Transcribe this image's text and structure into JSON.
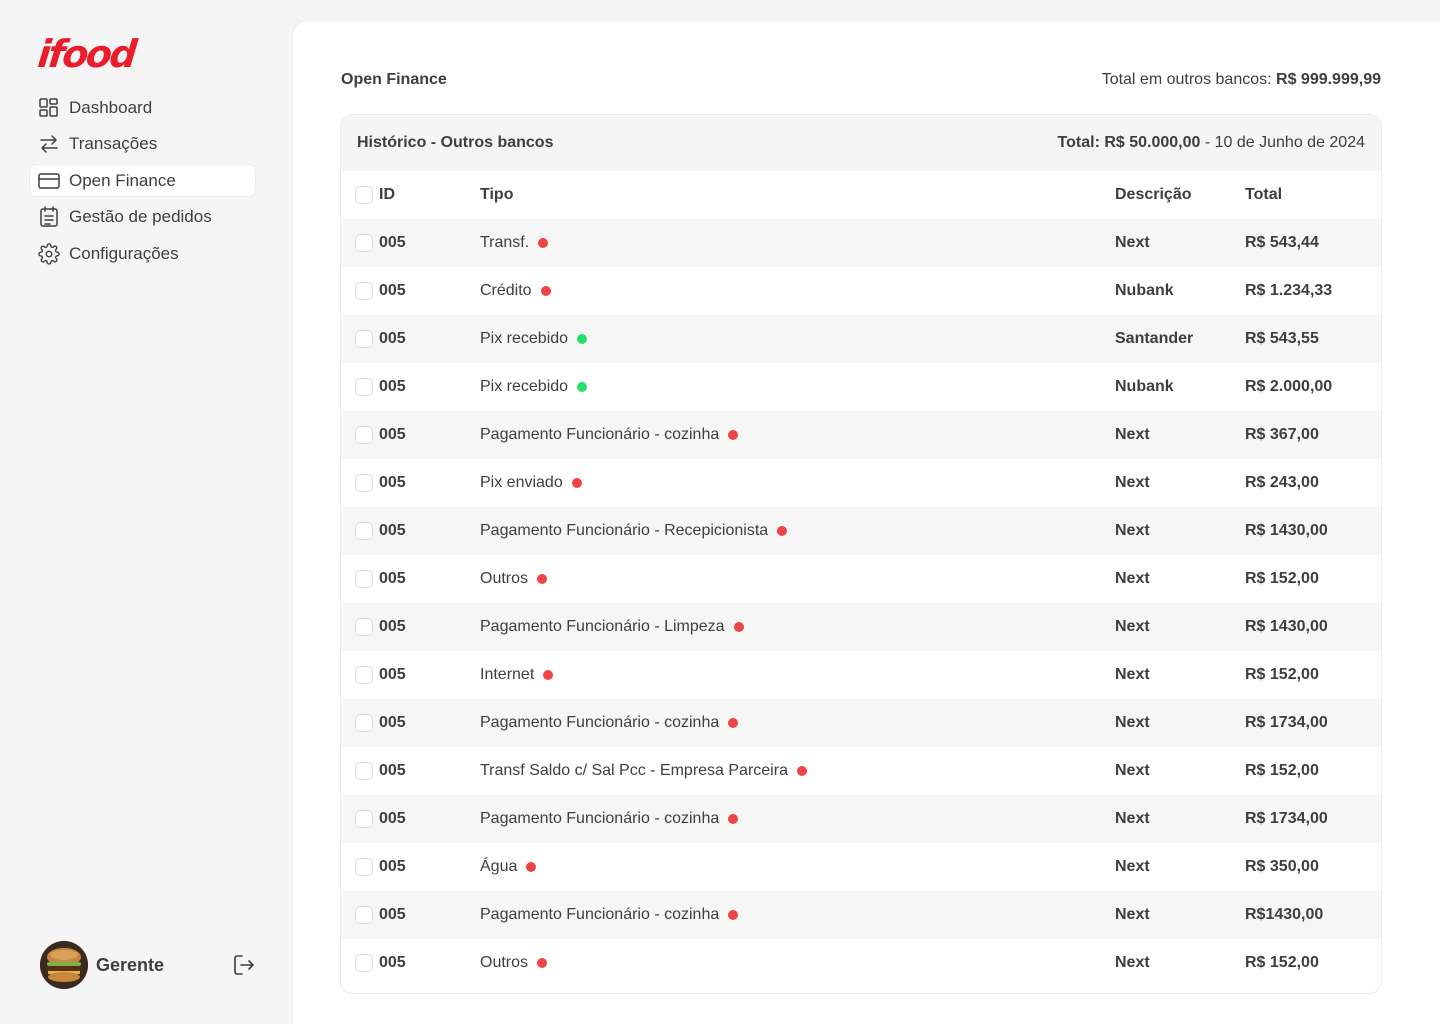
{
  "brand": {
    "logo_text": "ifood",
    "color": "#ea1d2c"
  },
  "sidebar": {
    "items": [
      {
        "label": "Dashboard",
        "icon": "grid-icon",
        "active": false
      },
      {
        "label": "Transações",
        "icon": "arrows-exchange-icon",
        "active": false
      },
      {
        "label": "Open Finance",
        "icon": "credit-card-icon",
        "active": true
      },
      {
        "label": "Gestão de pedidos",
        "icon": "clipboard-icon",
        "active": false
      },
      {
        "label": "Configurações",
        "icon": "gear-icon",
        "active": false
      }
    ],
    "user": {
      "name": "Gerente",
      "avatar": "burger-avatar",
      "logout_icon": "logout-icon"
    }
  },
  "main": {
    "title": "Open Finance",
    "total_other_label": "Total em outros bancos:",
    "total_other_value": "R$ 999.999,99"
  },
  "table": {
    "title": "Histórico - Outros bancos",
    "total_label": "Total: R$ 50.000,00",
    "total_date": " - 10 de Junho de 2024",
    "columns": {
      "id": "ID",
      "tipo": "Tipo",
      "descricao": "Descrição",
      "total": "Total"
    },
    "status_colors": {
      "red": "#ef4444",
      "green": "#22e06b"
    },
    "rows": [
      {
        "id": "005",
        "tipo": "Transf.",
        "status": "red",
        "descricao": "Next",
        "total": "R$ 543,44"
      },
      {
        "id": "005",
        "tipo": "Crédito",
        "status": "red",
        "descricao": "Nubank",
        "total": "R$ 1.234,33"
      },
      {
        "id": "005",
        "tipo": "Pix recebido",
        "status": "green",
        "descricao": "Santander",
        "total": "R$ 543,55"
      },
      {
        "id": "005",
        "tipo": "Pix recebido",
        "status": "green",
        "descricao": "Nubank",
        "total": "R$ 2.000,00"
      },
      {
        "id": "005",
        "tipo": "Pagamento Funcionário - cozinha",
        "status": "red",
        "descricao": "Next",
        "total": "R$ 367,00"
      },
      {
        "id": "005",
        "tipo": "Pix enviado",
        "status": "red",
        "descricao": "Next",
        "total": "R$ 243,00"
      },
      {
        "id": "005",
        "tipo": "Pagamento Funcionário - Recepicionista",
        "status": "red",
        "descricao": "Next",
        "total": "R$ 1430,00"
      },
      {
        "id": "005",
        "tipo": "Outros",
        "status": "red",
        "descricao": "Next",
        "total": "R$ 152,00"
      },
      {
        "id": "005",
        "tipo": "Pagamento Funcionário - Limpeza",
        "status": "red",
        "descricao": "Next",
        "total": "R$ 1430,00"
      },
      {
        "id": "005",
        "tipo": "Internet",
        "status": "red",
        "descricao": "Next",
        "total": "R$ 152,00"
      },
      {
        "id": "005",
        "tipo": "Pagamento Funcionário - cozinha",
        "status": "red",
        "descricao": "Next",
        "total": "R$ 1734,00"
      },
      {
        "id": "005",
        "tipo": "Transf Saldo c/ Sal Pcc - Empresa Parceira",
        "status": "red",
        "descricao": "Next",
        "total": "R$ 152,00"
      },
      {
        "id": "005",
        "tipo": "Pagamento Funcionário - cozinha",
        "status": "red",
        "descricao": "Next",
        "total": "R$ 1734,00"
      },
      {
        "id": "005",
        "tipo": "Água",
        "status": "red",
        "descricao": "Next",
        "total": "R$ 350,00"
      },
      {
        "id": "005",
        "tipo": "Pagamento Funcionário - cozinha",
        "status": "red",
        "descricao": "Next",
        "total": "R$1430,00"
      },
      {
        "id": "005",
        "tipo": "Outros",
        "status": "red",
        "descricao": "Next",
        "total": "R$ 152,00"
      }
    ]
  }
}
